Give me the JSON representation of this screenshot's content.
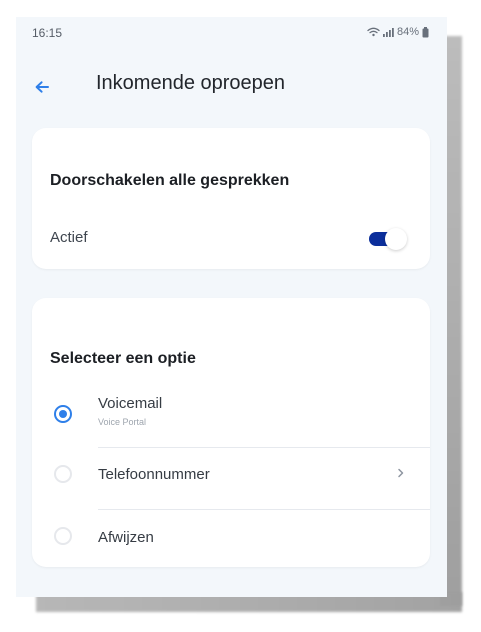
{
  "status_bar": {
    "time": "16:15",
    "battery": "84%",
    "icons": [
      "wifi-icon",
      "signal-icon",
      "battery-icon"
    ]
  },
  "header": {
    "title": "Inkomende oproepen",
    "back_icon": "arrow-left-icon",
    "accent_color": "#2e7fe9"
  },
  "forward_card": {
    "title": "Doorschakelen alle gesprekken",
    "toggle_label": "Actief",
    "toggle_on": true,
    "toggle_color": "#0b2e9b"
  },
  "options_card": {
    "title": "Selecteer een optie",
    "options": [
      {
        "label": "Voicemail",
        "sublabel": "Voice Portal",
        "selected": true
      },
      {
        "label": "Telefoonnummer",
        "selected": false,
        "has_chevron": true
      },
      {
        "label": "Afwijzen",
        "selected": false
      }
    ],
    "selected_color": "#2e7fe9"
  },
  "colors": {
    "background": "#f3f7fb",
    "card": "#ffffff",
    "text_primary": "#1c1f24",
    "text_secondary": "#3f464f"
  }
}
